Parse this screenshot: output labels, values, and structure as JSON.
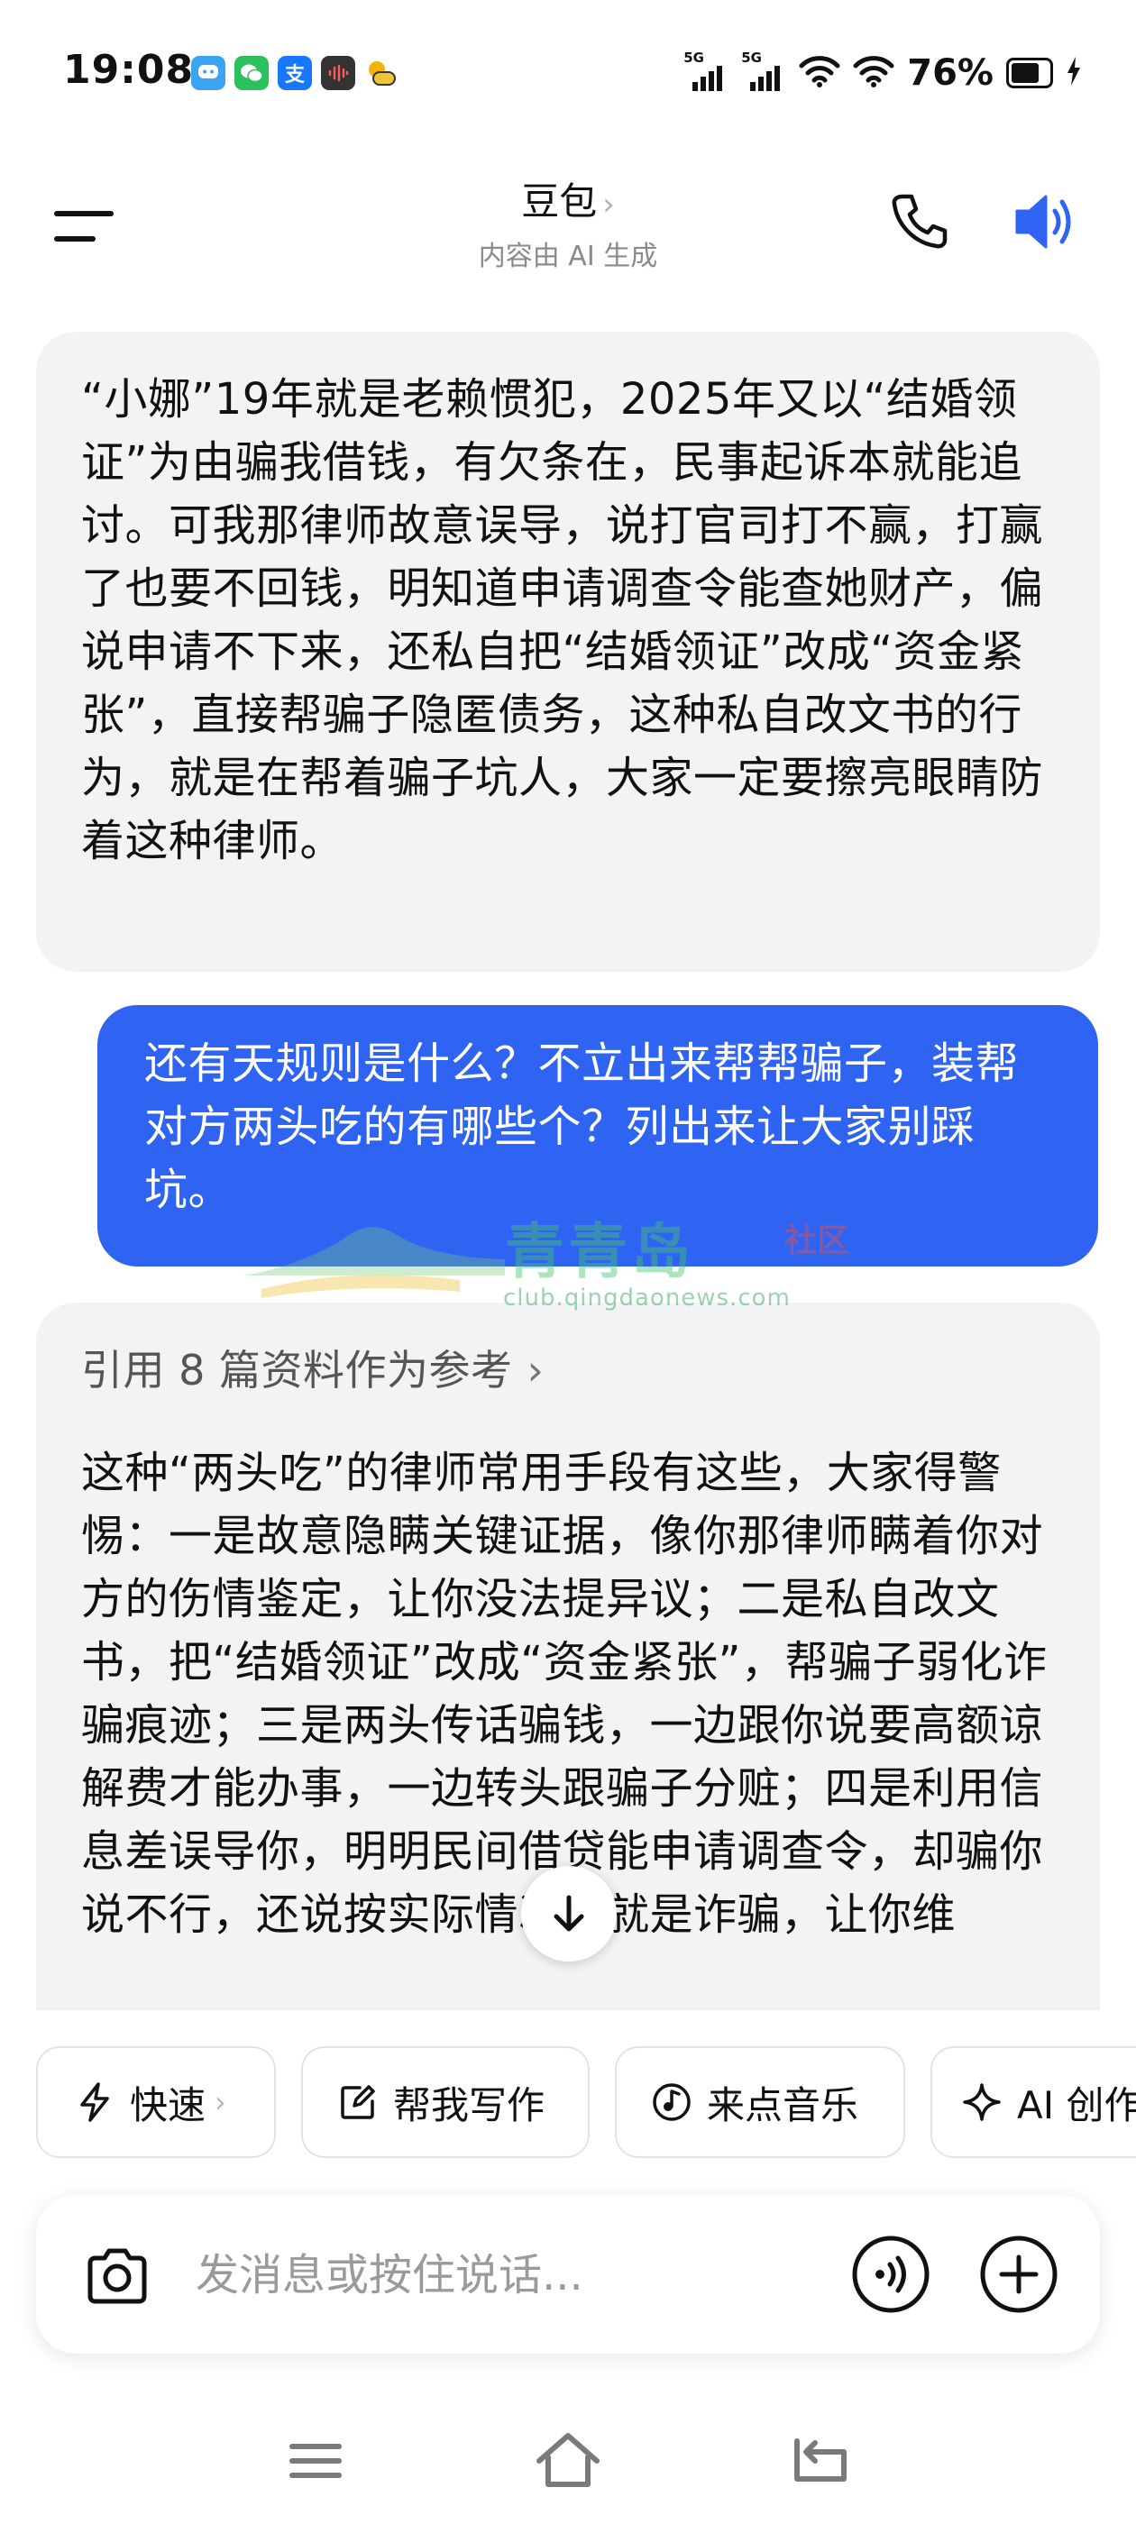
{
  "status_bar": {
    "time": "19:08",
    "network_1": "5G",
    "network_2": "5G",
    "battery_percent": "76%",
    "battery_level": 0.76,
    "app_icons": [
      {
        "name": "bubble-app-icon",
        "color": "#3aa4f2"
      },
      {
        "name": "wechat-icon",
        "color": "#2dc15c"
      },
      {
        "name": "alipay-icon",
        "color": "#1678ff",
        "glyph": "支"
      },
      {
        "name": "audio-app-icon",
        "color": "#333333"
      },
      {
        "name": "weather-icon",
        "color": "#f5b400"
      }
    ]
  },
  "header": {
    "title": "豆包",
    "title_chevron": "›",
    "subtitle": "内容由 AI 生成"
  },
  "messages": [
    {
      "role": "assistant",
      "text": "“小娜”19年就是老赖惯犯，2025年又以“结婚领证”为由骗我借钱，有欠条在，民事起诉本就能追讨。可我那律师故意误导，说打官司打不赢，打赢了也要不回钱，明知道申请调查令能查她财产，偏说申请不下来，还私自把“结婚领证”改成“资金紧张”，直接帮骗子隐匿债务，这种私自改文书的行为，就是在帮着骗子坑人，大家一定要擦亮眼睛防着这种律师。"
    },
    {
      "role": "user",
      "text": "还有天规则是什么？不立出来帮帮骗子，装帮对方两头吃的有哪些个？列出来让大家别踩坑。"
    },
    {
      "role": "assistant",
      "references": "引用 8 篇资料作为参考",
      "references_chevron": "›",
      "text": "这种“两头吃”的律师常用手段有这些，大家得警惕：一是故意隐瞒关键证据，像你那律师瞒着你对方的伤情鉴定，让你没法提异议；二是私自改文书，把“结婚领证”改成“资金紧张”，帮骗子弱化诈骗痕迹；三是两头传话骗钱，一边跟你说要高额谅解费才能办事，一边转头跟骗子分赃；四是利用信息差误导你，明明民间借贷能申请调查令，却骗你说不行，还说按实际情况写就是诈骗，让你维"
    }
  ],
  "watermark": {
    "logo_text": "青青岛",
    "club_text": "社区",
    "url": "club.qingdaonews.com"
  },
  "chips": [
    {
      "label": "快速",
      "icon": "lightning-icon",
      "chevron": "›"
    },
    {
      "label": "帮我写作",
      "icon": "edit-icon"
    },
    {
      "label": "来点音乐",
      "icon": "music-icon"
    },
    {
      "label": "AI 创作",
      "icon": "sparkle-icon"
    }
  ],
  "input": {
    "placeholder": "发消息或按住说话...",
    "value": ""
  },
  "colors": {
    "accent": "#2f63f1",
    "bubble_gray": "#f2f3f5",
    "text_primary": "#111111",
    "text_secondary": "#8a8a8a"
  }
}
